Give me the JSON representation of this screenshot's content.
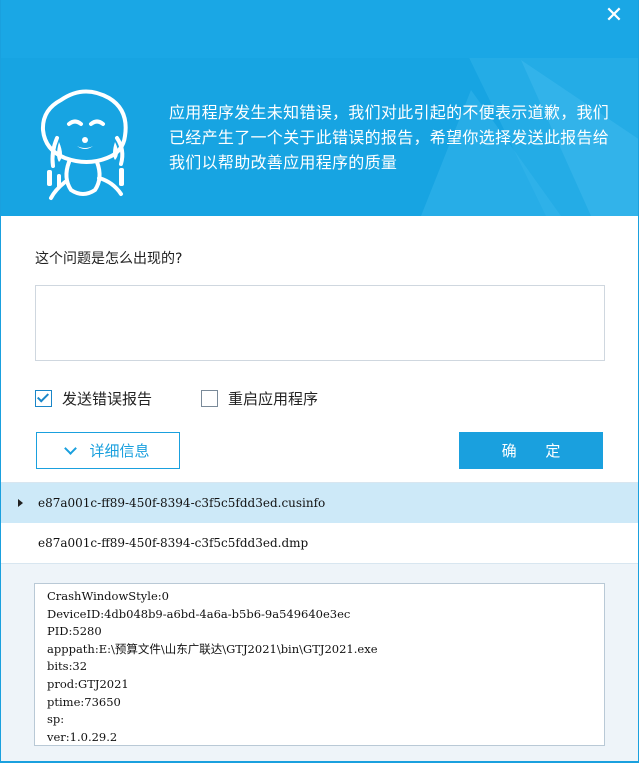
{
  "window": {
    "close_label": "✕",
    "accent_color": "#1aa0de"
  },
  "banner": {
    "message": "应用程序发生未知错误，我们对此引起的不便表示道歉，我们已经产生了一个关于此错误的报告，希望你选择发送此报告给我们以帮助改善应用程序的质量"
  },
  "form": {
    "question": "这个问题是怎么出现的?",
    "description_value": "",
    "send_report": {
      "label": "发送错误报告",
      "checked": true
    },
    "restart_app": {
      "label": "重启应用程序",
      "checked": false
    },
    "details_button": "详细信息",
    "ok_button": "确 定"
  },
  "files": [
    {
      "name": "e87a001c-ff89-450f-8394-c3f5c5fdd3ed.cusinfo",
      "selected": true
    },
    {
      "name": "e87a001c-ff89-450f-8394-c3f5c5fdd3ed.dmp",
      "selected": false
    }
  ],
  "info": {
    "lines": [
      "CrashWindowStyle:0",
      "DeviceID:4db048b9-a6bd-4a6a-b5b6-9a549640e3ec",
      "PID:5280",
      "apppath:E:\\预算文件\\山东广联达\\GTJ2021\\bin\\GTJ2021.exe",
      "bits:32",
      "prod:GTJ2021",
      "ptime:73650",
      "sp:",
      "ver:1.0.29.2"
    ]
  }
}
